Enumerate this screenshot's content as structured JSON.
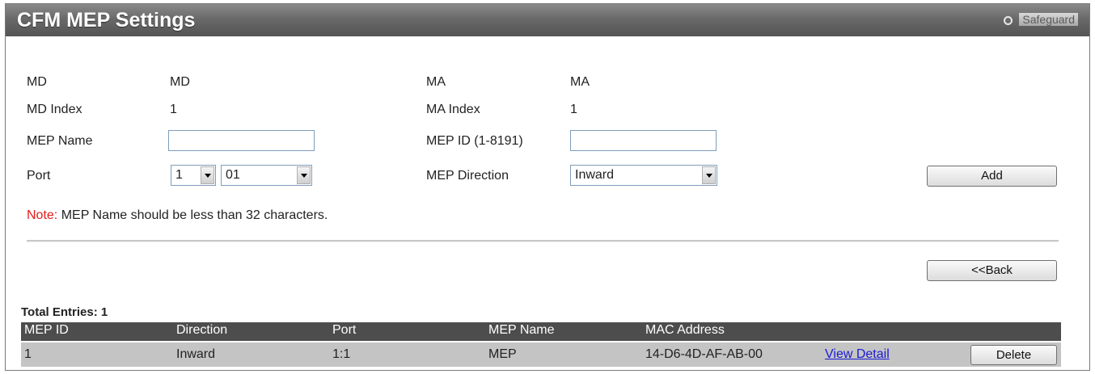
{
  "window": {
    "title": "CFM MEP Settings",
    "safeguard_label": "Safeguard"
  },
  "form": {
    "md_label": "MD",
    "md_value": "MD",
    "ma_label": "MA",
    "ma_value": "MA",
    "md_index_label": "MD Index",
    "md_index_value": "1",
    "ma_index_label": "MA Index",
    "ma_index_value": "1",
    "mep_name_label": "MEP Name",
    "mep_name_value": "",
    "mep_id_label": "MEP ID (1-8191)",
    "mep_id_value": "",
    "port_label": "Port",
    "port_unit_value": "1",
    "port_value": "01",
    "mep_direction_label": "MEP Direction",
    "mep_direction_value": "Inward",
    "add_button": "Add",
    "note_prefix": "Note:",
    "note_text": " MEP Name should be less than 32 characters.",
    "back_button": "<<Back"
  },
  "table": {
    "total_entries_label": "Total Entries: 1",
    "columns": [
      "MEP ID",
      "Direction",
      "Port",
      "MEP Name",
      "MAC Address"
    ],
    "rows": [
      {
        "mep_id": "1",
        "direction": "Inward",
        "port": "1:1",
        "mep_name": "MEP",
        "mac_address": "14-D6-4D-AF-AB-00",
        "view_detail": "View Detail",
        "delete": "Delete"
      }
    ]
  }
}
